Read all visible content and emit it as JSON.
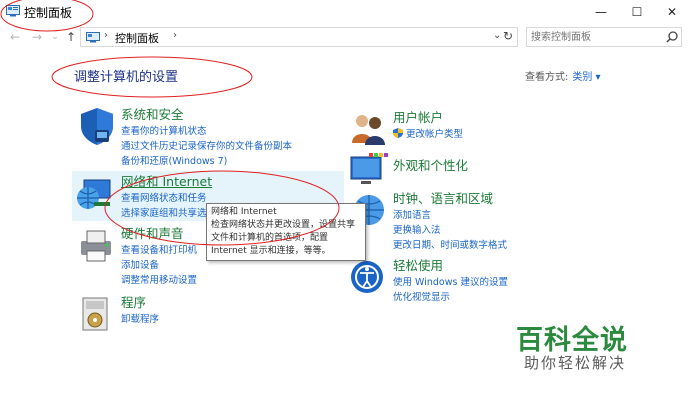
{
  "window": {
    "title": "控制面板",
    "minimize_glyph": "—",
    "maximize_glyph": "☐",
    "close_glyph": "✕"
  },
  "nav": {
    "back_glyph": "←",
    "forward_glyph": "→",
    "dropdown_glyph": "⌄",
    "up_glyph": "↑",
    "address_separator": "›",
    "address_crumb": "控制面板",
    "address_dropdown_glyph": "⌄",
    "refresh_glyph": "↻",
    "search_placeholder": "搜索控制面板"
  },
  "main": {
    "page_title": "调整计算机的设置",
    "view_by_label": "查看方式:",
    "view_by_value": "类别 ▾"
  },
  "categories_left": [
    {
      "title": "系统和安全",
      "icon": "shield-icon",
      "links": [
        "查看你的计算机状态",
        "通过文件历史记录保存你的文件备份副本",
        "备份和还原(Windows 7)"
      ]
    },
    {
      "title": "网络和 Internet",
      "icon": "network-globe-icon",
      "links": [
        "查看网络状态和任务",
        "选择家庭组和共享选"
      ]
    },
    {
      "title": "硬件和声音",
      "icon": "printer-icon",
      "links": [
        "查看设备和打印机",
        "添加设备",
        "调整常用移动设置"
      ]
    },
    {
      "title": "程序",
      "icon": "programs-icon",
      "links": [
        "卸载程序"
      ]
    }
  ],
  "categories_right": [
    {
      "title": "用户帐户",
      "icon": "users-icon",
      "links": [
        "更改帐户类型"
      ]
    },
    {
      "title": "外观和个性化",
      "icon": "monitor-palette-icon",
      "links": []
    },
    {
      "title": "时钟、语言和区域",
      "icon": "clock-globe-icon",
      "links": [
        "添加语言",
        "更换输入法",
        "更改日期、时间或数字格式"
      ]
    },
    {
      "title": "轻松使用",
      "icon": "ease-of-access-icon",
      "links": [
        "使用 Windows 建议的设置",
        "优化视觉显示"
      ]
    }
  ],
  "tooltip": {
    "title": "网络和 Internet",
    "line1": "检查网络状态并更改设置，设置共享",
    "line2": "文件和计算机的首选项，配置",
    "line3": "Internet 显示和连接，等等。"
  },
  "watermark": {
    "brand": "百科全说",
    "slogan": "助你轻松解决"
  },
  "colors": {
    "heading_green": "#1a7a36",
    "link_blue": "#1a64c8",
    "title_blue": "#1e3287",
    "annotation_red": "#e02020",
    "watermark_green": "#2c8a3f"
  }
}
